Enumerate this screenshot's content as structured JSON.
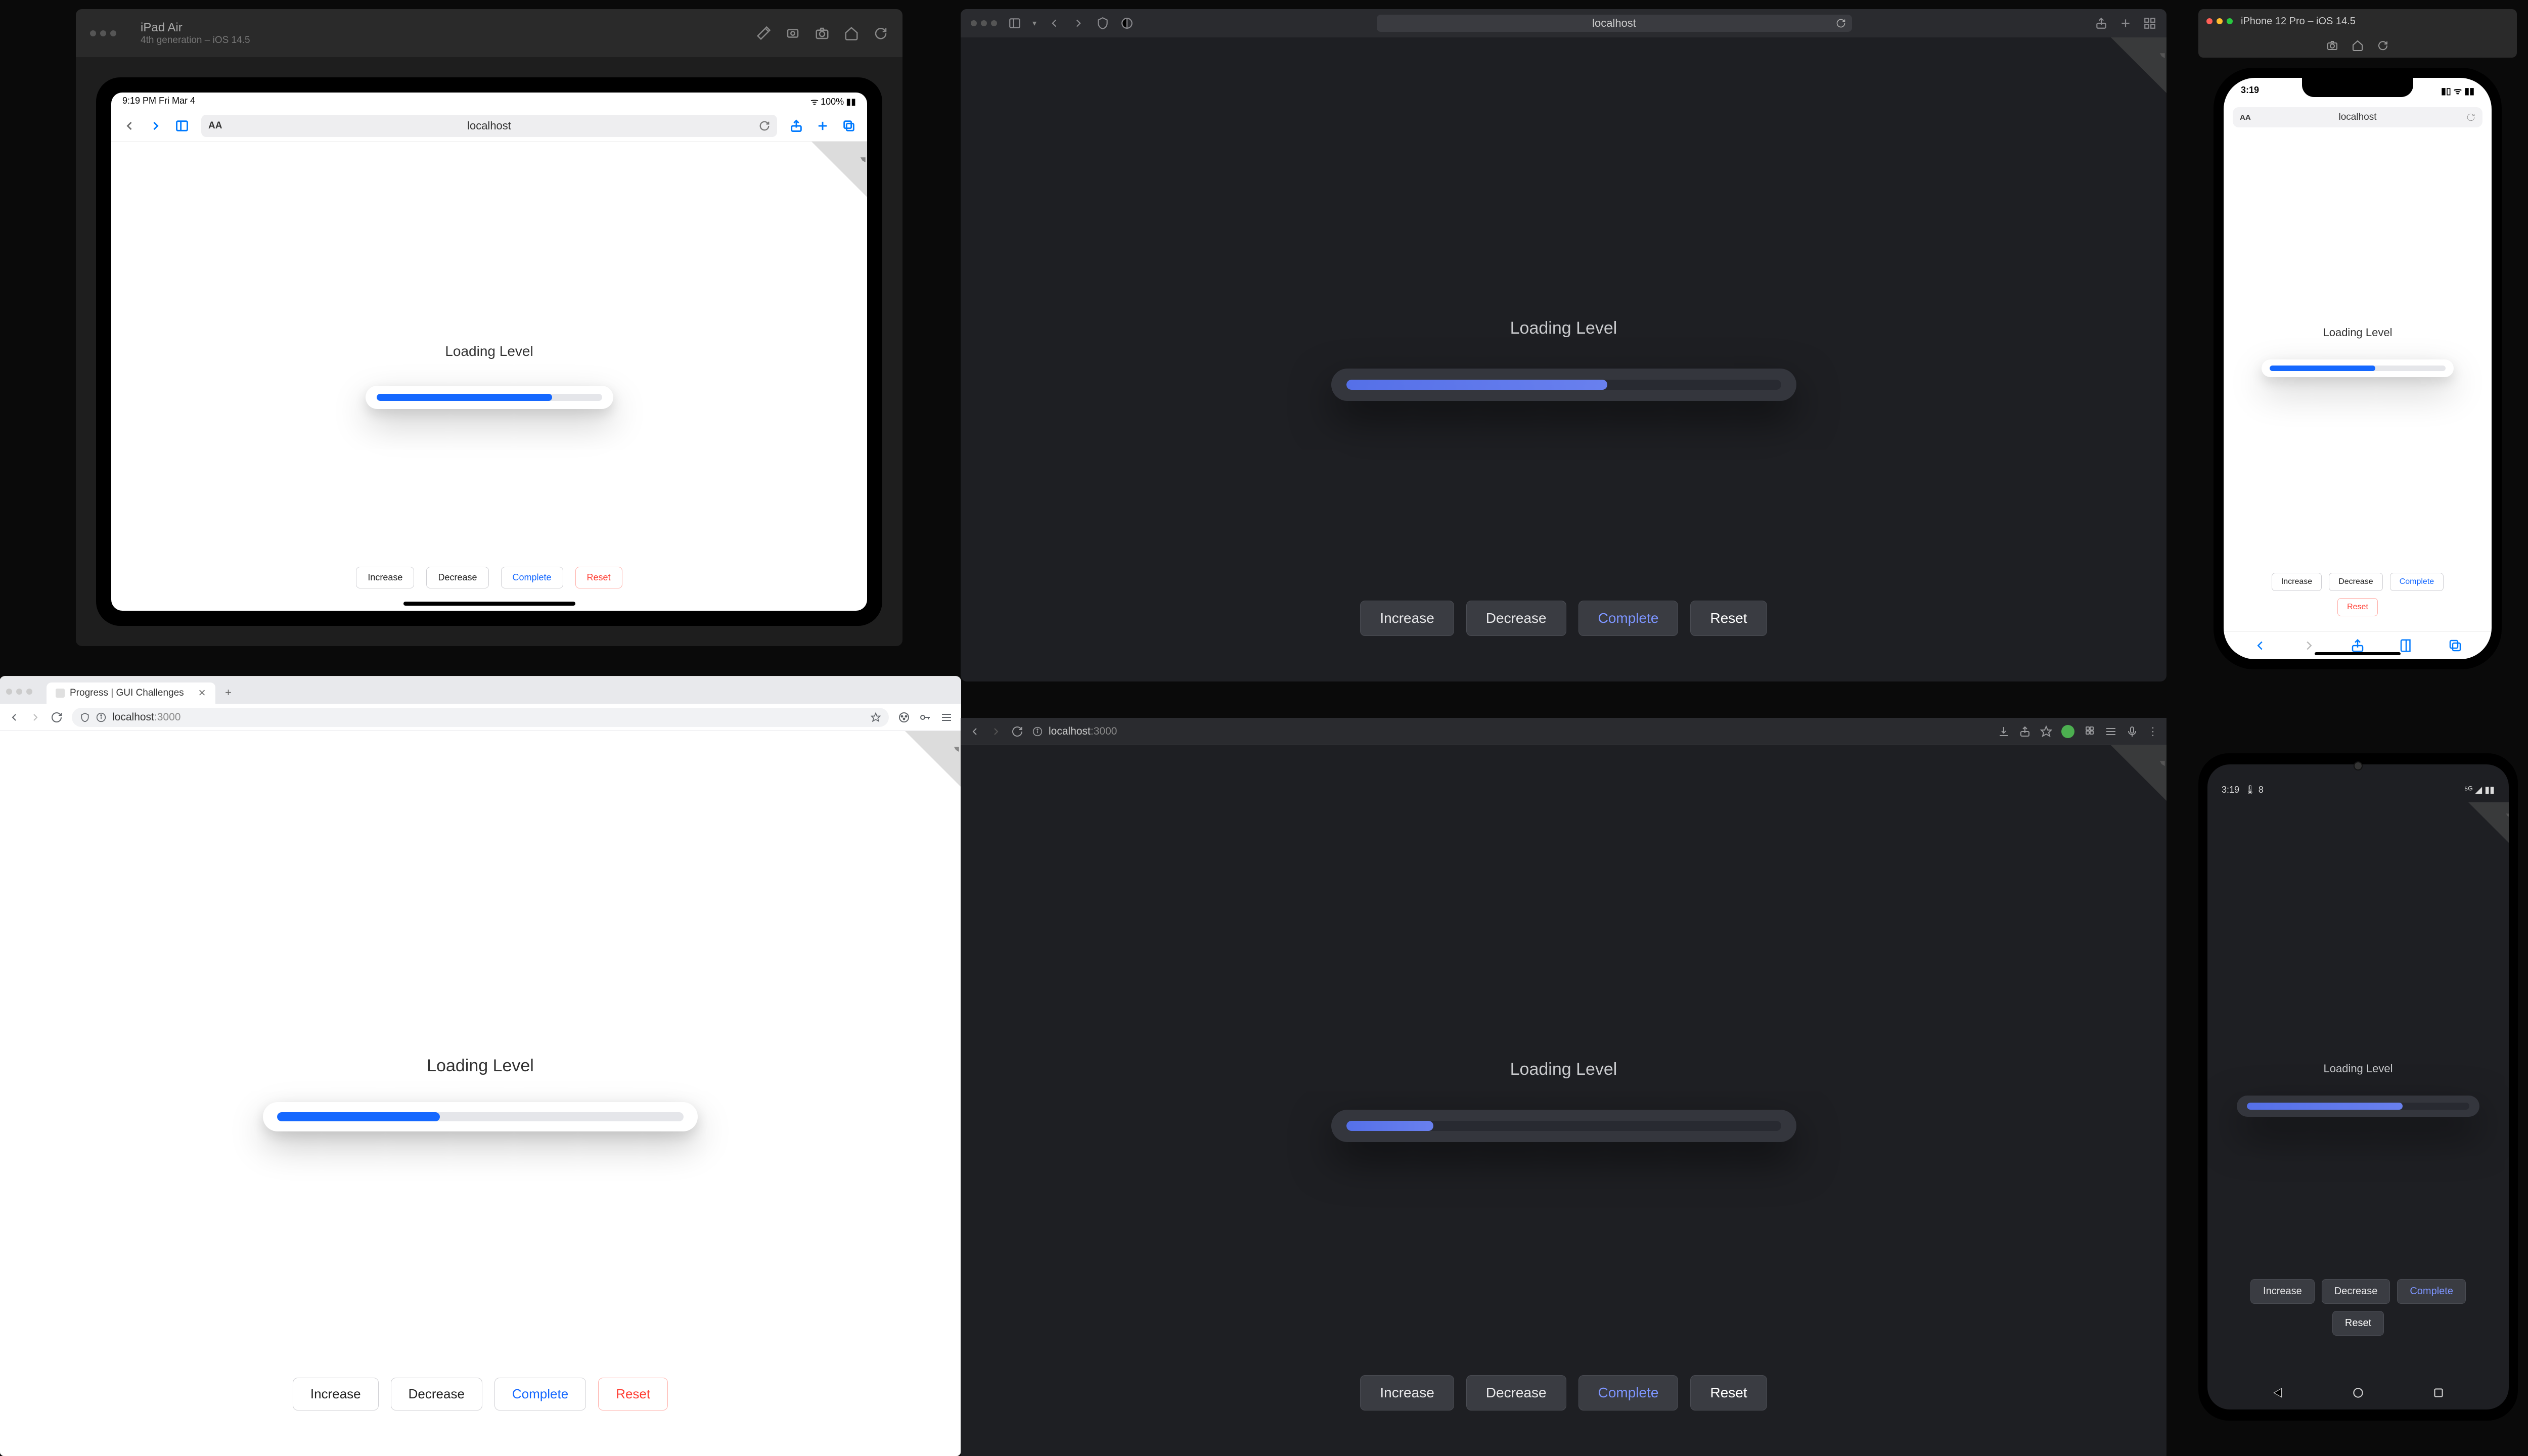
{
  "ipad_sim": {
    "title": "iPad Air",
    "subtitle": "4th generation – iOS 14.5",
    "status_left": "9:19 PM  Fri Mar 4",
    "status_right": "100%",
    "url": "localhost"
  },
  "safari_dark": {
    "url": "localhost"
  },
  "iphone_sim": {
    "title": "iPhone 12 Pro – iOS 14.5",
    "time": "3:19",
    "url": "localhost"
  },
  "chrome_light": {
    "tab_title": "Progress | GUI Challenges",
    "url_host": "localhost",
    "url_port": ":3000"
  },
  "chrome_dark": {
    "url_host": "localhost",
    "url_port": ":3000"
  },
  "android": {
    "time": "3:19",
    "temp": "8"
  },
  "widget": {
    "label": "Loading Level",
    "btn_increase": "Increase",
    "btn_decrease": "Decrease",
    "btn_complete": "Complete",
    "btn_reset": "Reset"
  },
  "progress_pct": {
    "ipad": 78,
    "safari_dark": 60,
    "iphone": 60,
    "chrome_light": 40,
    "chrome_dark": 20,
    "android": 70
  }
}
